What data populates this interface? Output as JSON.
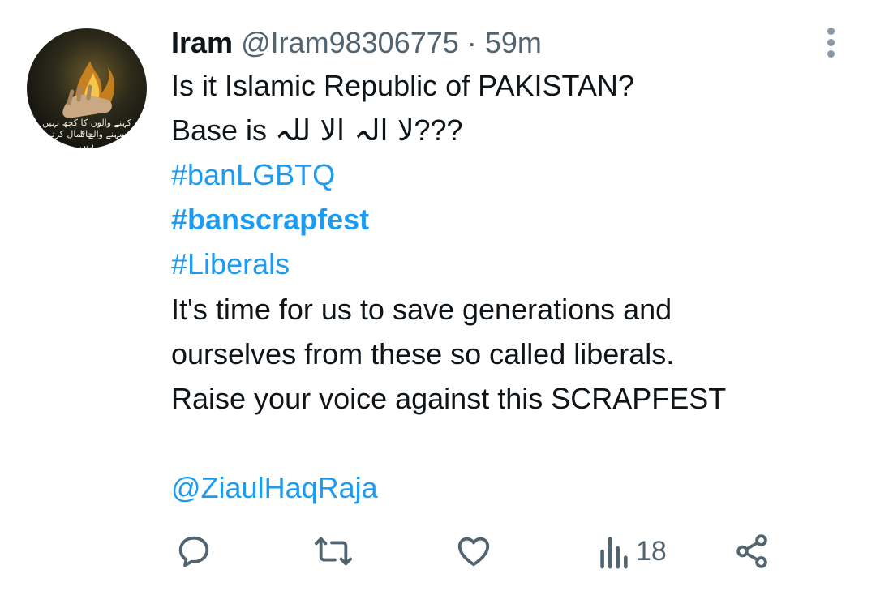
{
  "tweet": {
    "author_name": "Iram",
    "handle": "@Iram98306775",
    "separator": "·",
    "time": "59m",
    "avatar_text": [
      "کہنے والوں کا کچھ نہیں جاتا",
      "سہنے والے کمال کرتے ہیں"
    ],
    "line1": "Is it Islamic Republic of PAKISTAN?",
    "line2_prefix": "Base is ",
    "line2_urdu": "لا الہ الا للہ",
    "line2_suffix": "???",
    "hashtags": [
      "#banLGBTQ",
      "#banscrapfest",
      "#Liberals"
    ],
    "body_lines": [
      "It's time for us to save generations and",
      "ourselves from these so called liberals.",
      "Raise your voice against this SCRAPFEST"
    ],
    "mention": "@ZiaulHaqRaja"
  },
  "actions": {
    "reply_icon": "reply-icon",
    "retweet_icon": "retweet-icon",
    "like_icon": "heart-icon",
    "views_icon": "views-icon",
    "views_count": "18",
    "share_icon": "share-icon"
  },
  "colors": {
    "link": "#1d9bf0",
    "secondary": "#536471",
    "text": "#0f1419"
  }
}
